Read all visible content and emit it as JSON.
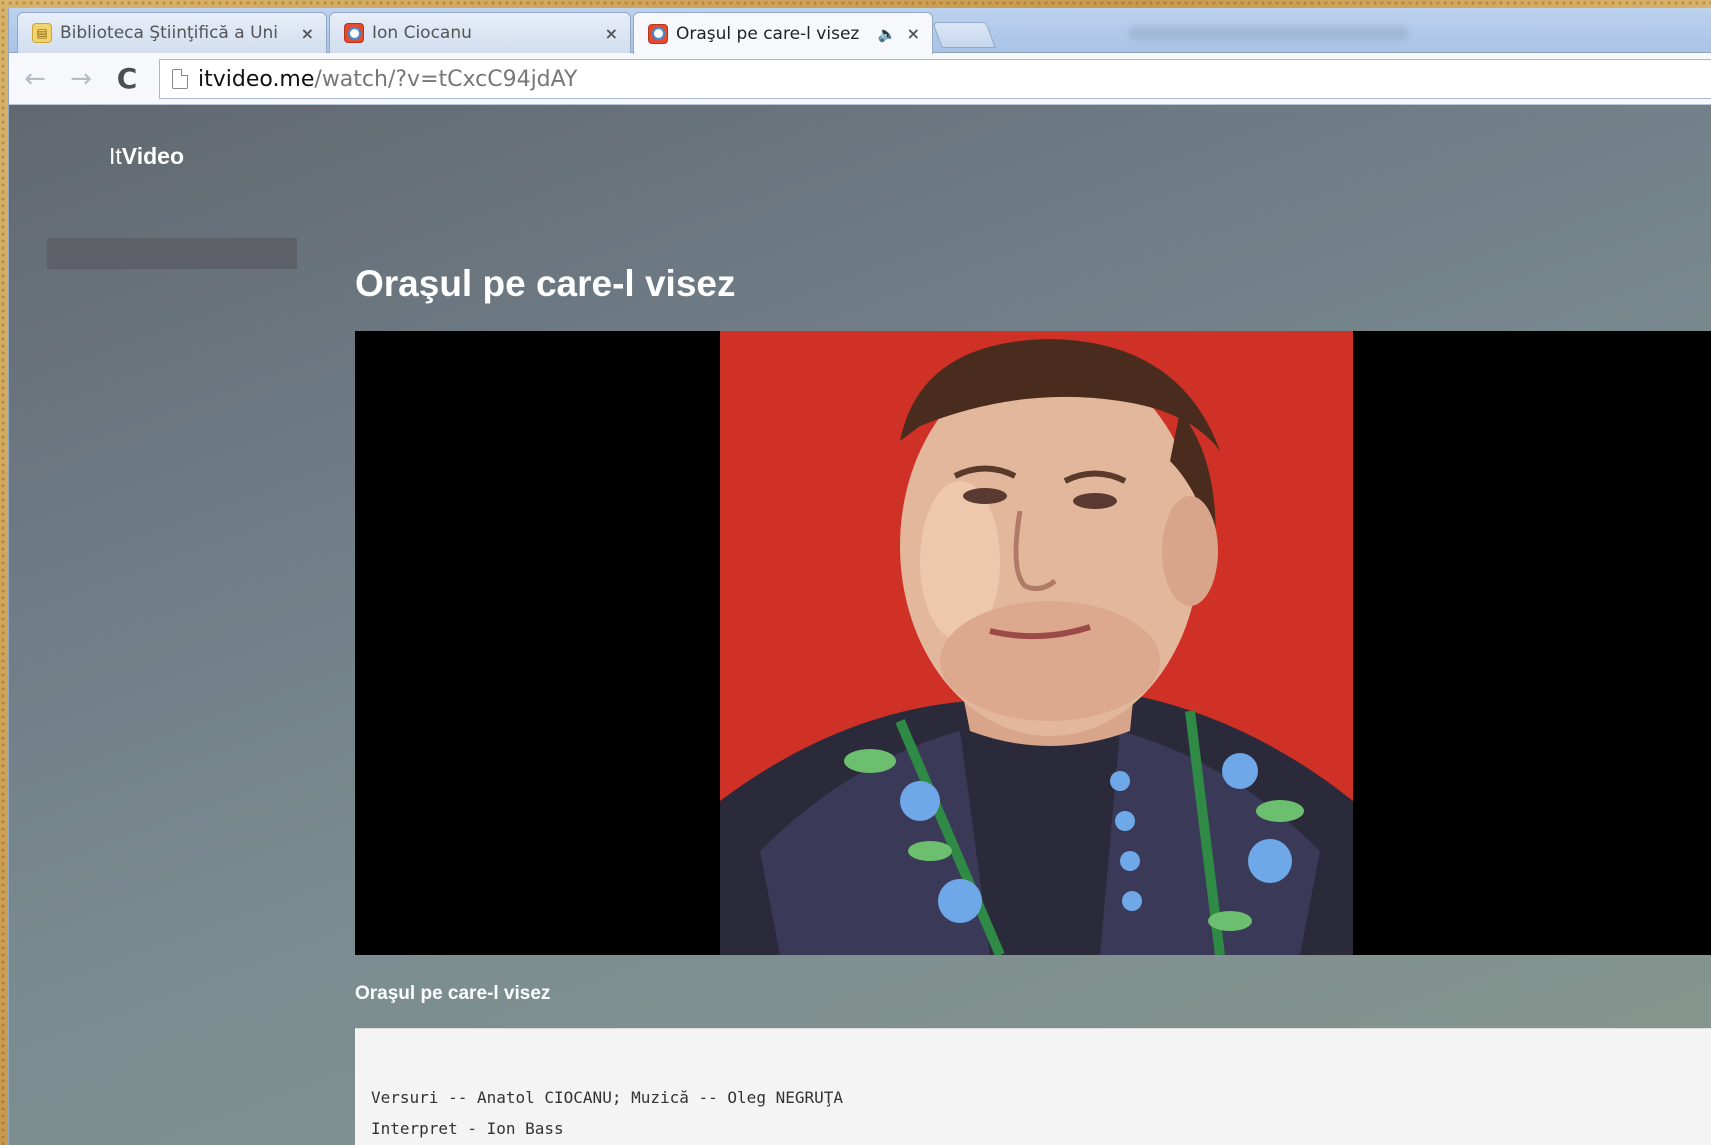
{
  "browser": {
    "tabs": [
      {
        "title": "Biblioteca Ştiinţifică a Uni",
        "active": false
      },
      {
        "title": "Ion Ciocanu",
        "active": false
      },
      {
        "title": "Oraşul pe care-l visez",
        "active": true
      }
    ],
    "close_glyph": "×",
    "audio_glyph": "🔈",
    "url_host": "itvideo.me",
    "url_path": "/watch/?v=tCxcC94jdAY",
    "back_glyph": "←",
    "forward_glyph": "→",
    "reload_glyph": "C"
  },
  "site": {
    "brand_part1": "It",
    "brand_part2": "Video"
  },
  "main": {
    "title": "Oraşul pe care-l visez",
    "video_caption": "Oraşul pe care-l visez",
    "description_lines": [
      "Versuri -- Anatol CIOCANU;  Muzică -- Oleg NEGRUŢA",
      "Interpret - Ion Bass"
    ]
  },
  "colors": {
    "thumbnail_background": "#cf3127",
    "video_background": "#000000",
    "page_gradient": [
      "#62686f",
      "#86978e"
    ]
  }
}
